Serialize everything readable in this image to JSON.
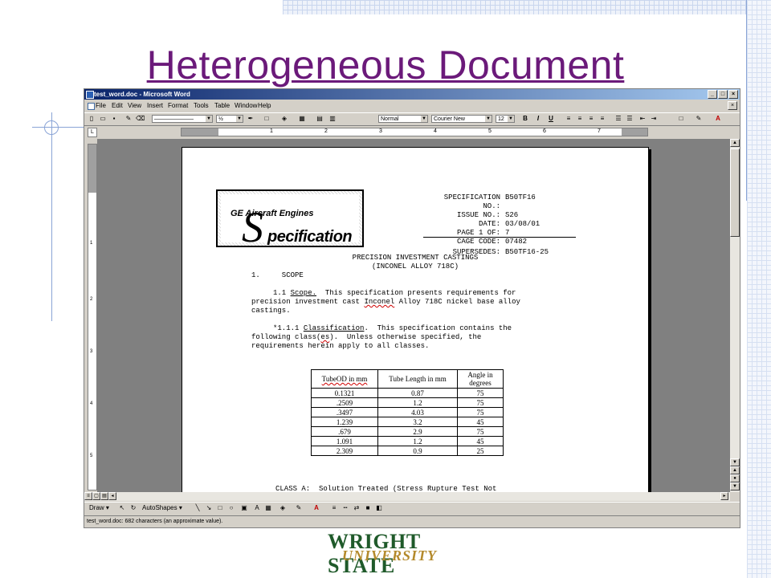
{
  "slide": {
    "title": "Heterogeneous Document",
    "footer_logo": {
      "line1": "WRIGHT STATE",
      "line2": "UNIVERSITY"
    }
  },
  "word": {
    "title": "test_word.doc - Microsoft Word",
    "menu": [
      "File",
      "Edit",
      "View",
      "Insert",
      "Format",
      "Tools",
      "Table",
      "Window",
      "Help"
    ],
    "toolbar": {
      "style": "Normal",
      "font": "Courier New",
      "size": "12",
      "line_weight": "½",
      "bold": "B",
      "italic": "I",
      "underline": "U"
    },
    "ruler_numbers": [
      "1",
      "2",
      "3",
      "4",
      "5",
      "6",
      "7"
    ],
    "vruler_numbers": [
      "1",
      "2",
      "3",
      "4",
      "5"
    ],
    "drawbar": {
      "draw": "Draw",
      "autoshapes": "AutoShapes"
    },
    "status": "test_word.doc: 682 characters (an approximate value)."
  },
  "document": {
    "logo": {
      "brand": "GE Aircraft Engines",
      "big_s": "S",
      "word": "pecification"
    },
    "spec_fields": [
      {
        "key": "SPECIFICATION NO.:",
        "value": "B50TF16"
      },
      {
        "key": "ISSUE NO.:",
        "value": "S26"
      },
      {
        "key": "DATE:",
        "value": "03/08/01"
      },
      {
        "key": "PAGE 1 OF:",
        "value": "7"
      },
      {
        "key": "CAGE CODE:",
        "value": "07482"
      },
      {
        "key": "SUPERSEDES:",
        "value": "B50TF16-25"
      }
    ],
    "heading1": "PRECISION INVESTMENT CASTINGS",
    "heading2": "(INCONEL ALLOY 718C)",
    "scope": "1.     SCOPE",
    "p1_num": "     1.1 ",
    "p1_label": "Scope.",
    "p1_line1_rest": "  This specification presents requirements for",
    "p1_line2a": "precision investment cast ",
    "p1_line2_squig": "Inconel",
    "p1_line2b": " Alloy 718C nickel base alloy",
    "p1_line3": "castings.",
    "p2_num": "     *1.1.1 ",
    "p2_label": "Classification",
    "p2_line1_rest": ".  This specification contains the",
    "p2_line2a": "following class(",
    "p2_line2_squig": "es",
    "p2_line2b": ").  Unless otherwise specified, the",
    "p2_line3": "requirements herein apply to all classes.",
    "class_a": "CLASS A:  Solution Treated (Stress Rupture Test Not",
    "table": {
      "headers": [
        "TubeOD in mm",
        "Tube Length in mm",
        "Angle in degrees"
      ],
      "rows": [
        [
          "0.1321",
          "0.87",
          "75"
        ],
        [
          ".2509",
          "1.2",
          "75"
        ],
        [
          ".3497",
          "4.03",
          "75"
        ],
        [
          "1.239",
          "3.2",
          "45"
        ],
        [
          ".679",
          "2.9",
          "75"
        ],
        [
          "1.091",
          "1.2",
          "45"
        ],
        [
          "2.309",
          "0.9",
          "25"
        ]
      ]
    }
  }
}
